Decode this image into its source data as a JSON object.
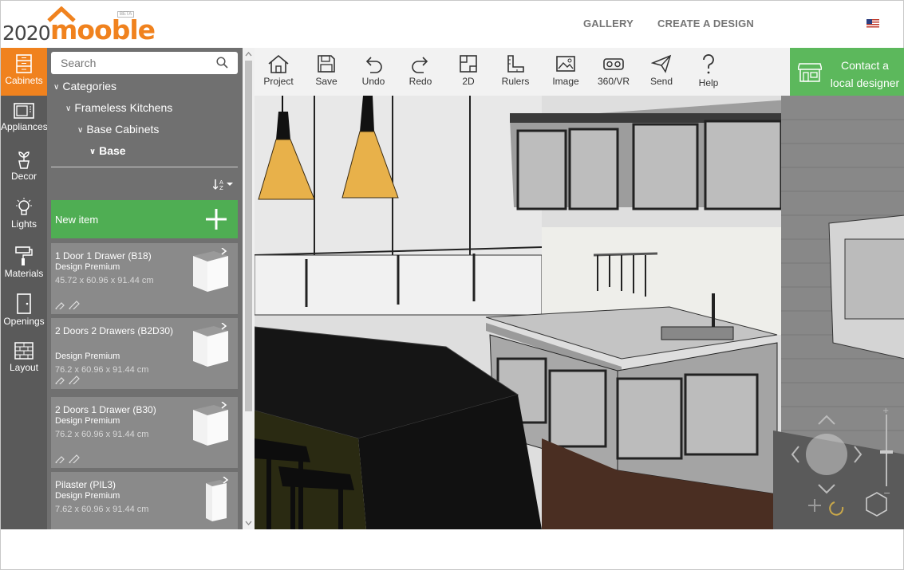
{
  "header": {
    "logo_prefix": "2020",
    "logo_brand": "mooble",
    "logo_badge": "BETA",
    "nav": [
      "GALLERY",
      "CREATE A DESIGN"
    ],
    "brand_color": "#f0821e"
  },
  "rail": {
    "items": [
      {
        "label": "Cabinets",
        "icon": "cabinet-icon",
        "active": true
      },
      {
        "label": "Appliances",
        "icon": "microwave-icon"
      },
      {
        "label": "Decor",
        "icon": "plant-icon"
      },
      {
        "label": "Lights",
        "icon": "bulb-icon"
      },
      {
        "label": "Materials",
        "icon": "paint-roller-icon"
      },
      {
        "label": "Openings",
        "icon": "door-icon"
      },
      {
        "label": "Layout",
        "icon": "brick-wall-icon"
      }
    ]
  },
  "panel": {
    "search_placeholder": "Search",
    "breadcrumbs": [
      "Categories",
      "Frameless Kitchens",
      "Base Cabinets",
      "Base"
    ],
    "new_item_label": "New item",
    "items": [
      {
        "name": "1 Door 1 Drawer (B18)",
        "tier": "Design Premium",
        "size": "45.72 x 60.96 x 91.44 cm"
      },
      {
        "name": "2 Doors 2 Drawers (B2D30)",
        "tier": "Design Premium",
        "size": "76.2 x 60.96 x 91.44 cm"
      },
      {
        "name": "2 Doors 1 Drawer (B30)",
        "tier": "Design Premium",
        "size": "76.2 x 60.96 x 91.44 cm"
      },
      {
        "name": "Pilaster (PIL3)",
        "tier": "Design Premium",
        "size": "7.62 x 60.96 x 91.44 cm"
      }
    ]
  },
  "toolbar": {
    "tools": [
      "Project",
      "Save",
      "Undo",
      "Redo",
      "2D",
      "Rulers",
      "Image",
      "360/VR",
      "Send",
      "Help"
    ],
    "contact_line1": "Contact a",
    "contact_line2": "local designer",
    "contact_color": "#5cb85c"
  }
}
